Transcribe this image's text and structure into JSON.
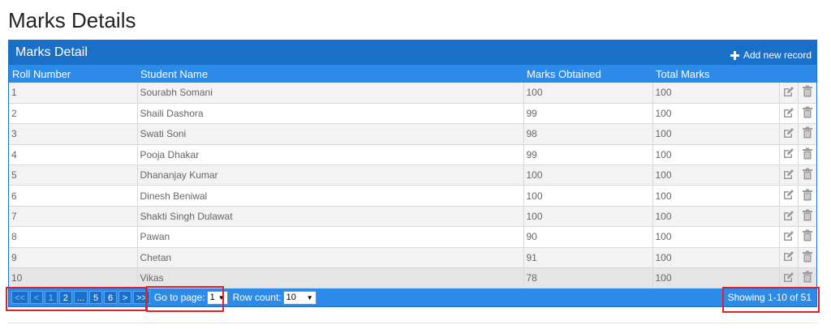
{
  "page": {
    "title": "Marks Details"
  },
  "grid": {
    "caption": "Marks Detail",
    "add_label": "Add new record",
    "columns": [
      "Roll Number",
      "Student Name",
      "Marks Obtained",
      "Total Marks"
    ],
    "rows": [
      [
        "1",
        "Sourabh Somani",
        "100",
        "100"
      ],
      [
        "2",
        "Shaili Dashora",
        "99",
        "100"
      ],
      [
        "3",
        "Swati Soni",
        "98",
        "100"
      ],
      [
        "4",
        "Pooja Dhakar",
        "99",
        "100"
      ],
      [
        "5",
        "Dhananjay Kumar",
        "100",
        "100"
      ],
      [
        "6",
        "Dinesh Beniwal",
        "100",
        "100"
      ],
      [
        "7",
        "Shakti Singh Dulawat",
        "100",
        "100"
      ],
      [
        "8",
        "Pawan",
        "90",
        "100"
      ],
      [
        "9",
        "Chetan",
        "91",
        "100"
      ],
      [
        "10",
        "Vikas",
        "78",
        "100"
      ]
    ],
    "row_icons": [
      "edit-icon",
      "trash-icon"
    ]
  },
  "footer": {
    "pager": {
      "first": "<<",
      "prev": "<",
      "pages_before": [
        "1",
        "2"
      ],
      "ellipsis": "...",
      "pages_after": [
        "5",
        "6"
      ],
      "next": ">",
      "last": ">>"
    },
    "goto_label": "Go to page:",
    "goto_value": "1",
    "rowcount_label": "Row count:",
    "rowcount_value": "10",
    "showing": "Showing 1-10 of 51"
  },
  "colors": {
    "header_dark": "#1a6fc9",
    "header_light": "#2c8ae8",
    "highlight": "#e0202a"
  }
}
